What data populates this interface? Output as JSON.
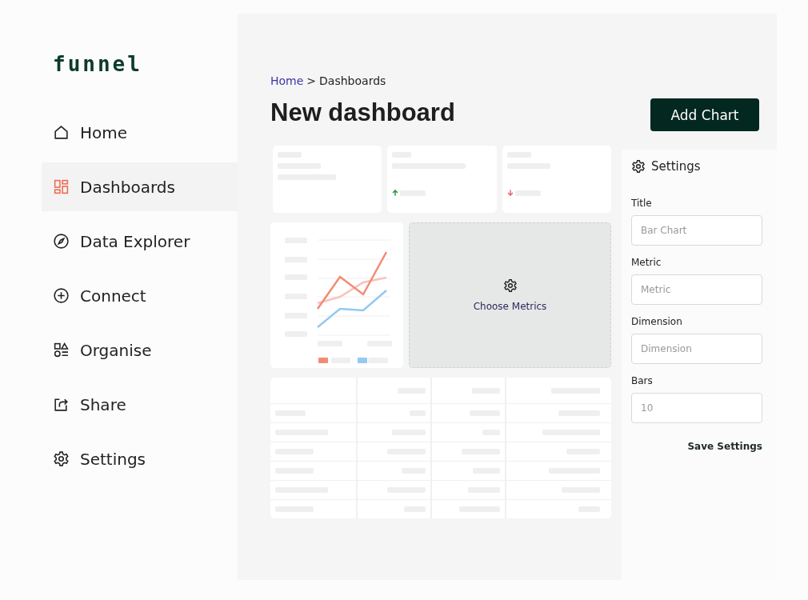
{
  "logo": "funnel",
  "sidebar": {
    "items": [
      {
        "label": "Home",
        "selected": false
      },
      {
        "label": "Dashboards",
        "selected": true
      },
      {
        "label": "Data Explorer",
        "selected": false
      },
      {
        "label": "Connect",
        "selected": false
      },
      {
        "label": "Organise",
        "selected": false
      },
      {
        "label": "Share",
        "selected": false
      },
      {
        "label": "Settings",
        "selected": false
      }
    ]
  },
  "breadcrumb": {
    "link": "Home",
    "separator": ">",
    "current": "Dashboards"
  },
  "title": "New dashboard",
  "add_button": "Add Chart",
  "empty_widget": {
    "label": "Choose Metrics"
  },
  "settings": {
    "title": "Settings",
    "fields": [
      {
        "label": "Title",
        "placeholder": "Bar Chart"
      },
      {
        "label": "Metric",
        "placeholder": "Metric"
      },
      {
        "label": "Dimension",
        "placeholder": "Dimension"
      },
      {
        "label": "Bars",
        "placeholder": "10"
      }
    ],
    "save": "Save Settings"
  }
}
